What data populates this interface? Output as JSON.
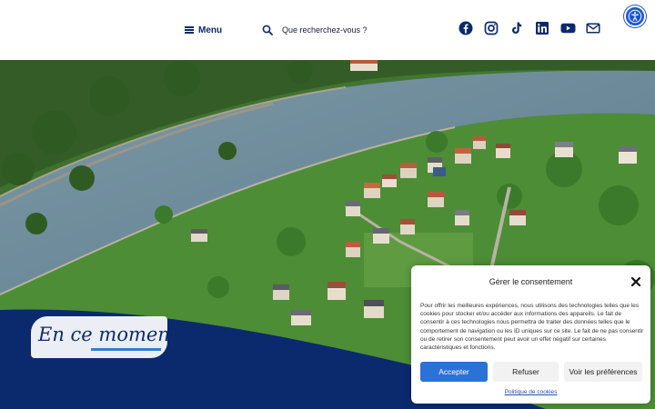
{
  "header": {
    "menu_label": "Menu",
    "search_placeholder": "Que recherchez-vous ?",
    "socials": [
      "facebook-icon",
      "instagram-icon",
      "tiktok-icon",
      "linkedin-icon",
      "youtube-icon",
      "mail-icon"
    ]
  },
  "hero": {
    "headline_part1": "En ce ",
    "headline_part2": "moment"
  },
  "consent": {
    "title": "Gérer le consentement",
    "body": "Pour offrir les meilleures expériences, nous utilisons des technologies telles que les cookies pour stocker et/ou accéder aux informations des appareils. Le fait de consentir à ces technologies nous permettra de traiter des données telles que le comportement de navigation ou les ID uniques sur ce site. Le fait de ne pas consentir ou de retirer son consentement peut avoir un effet négatif sur certaines caractéristiques et fonctions.",
    "accept_label": "Accepter",
    "refuse_label": "Refuser",
    "prefs_label": "Voir les préférences",
    "policy_label": "Politique de cookies"
  },
  "colors": {
    "brand_navy": "#0d2a6b",
    "accent_blue": "#2a72d6",
    "accessibility_blue": "#1d55d6"
  }
}
